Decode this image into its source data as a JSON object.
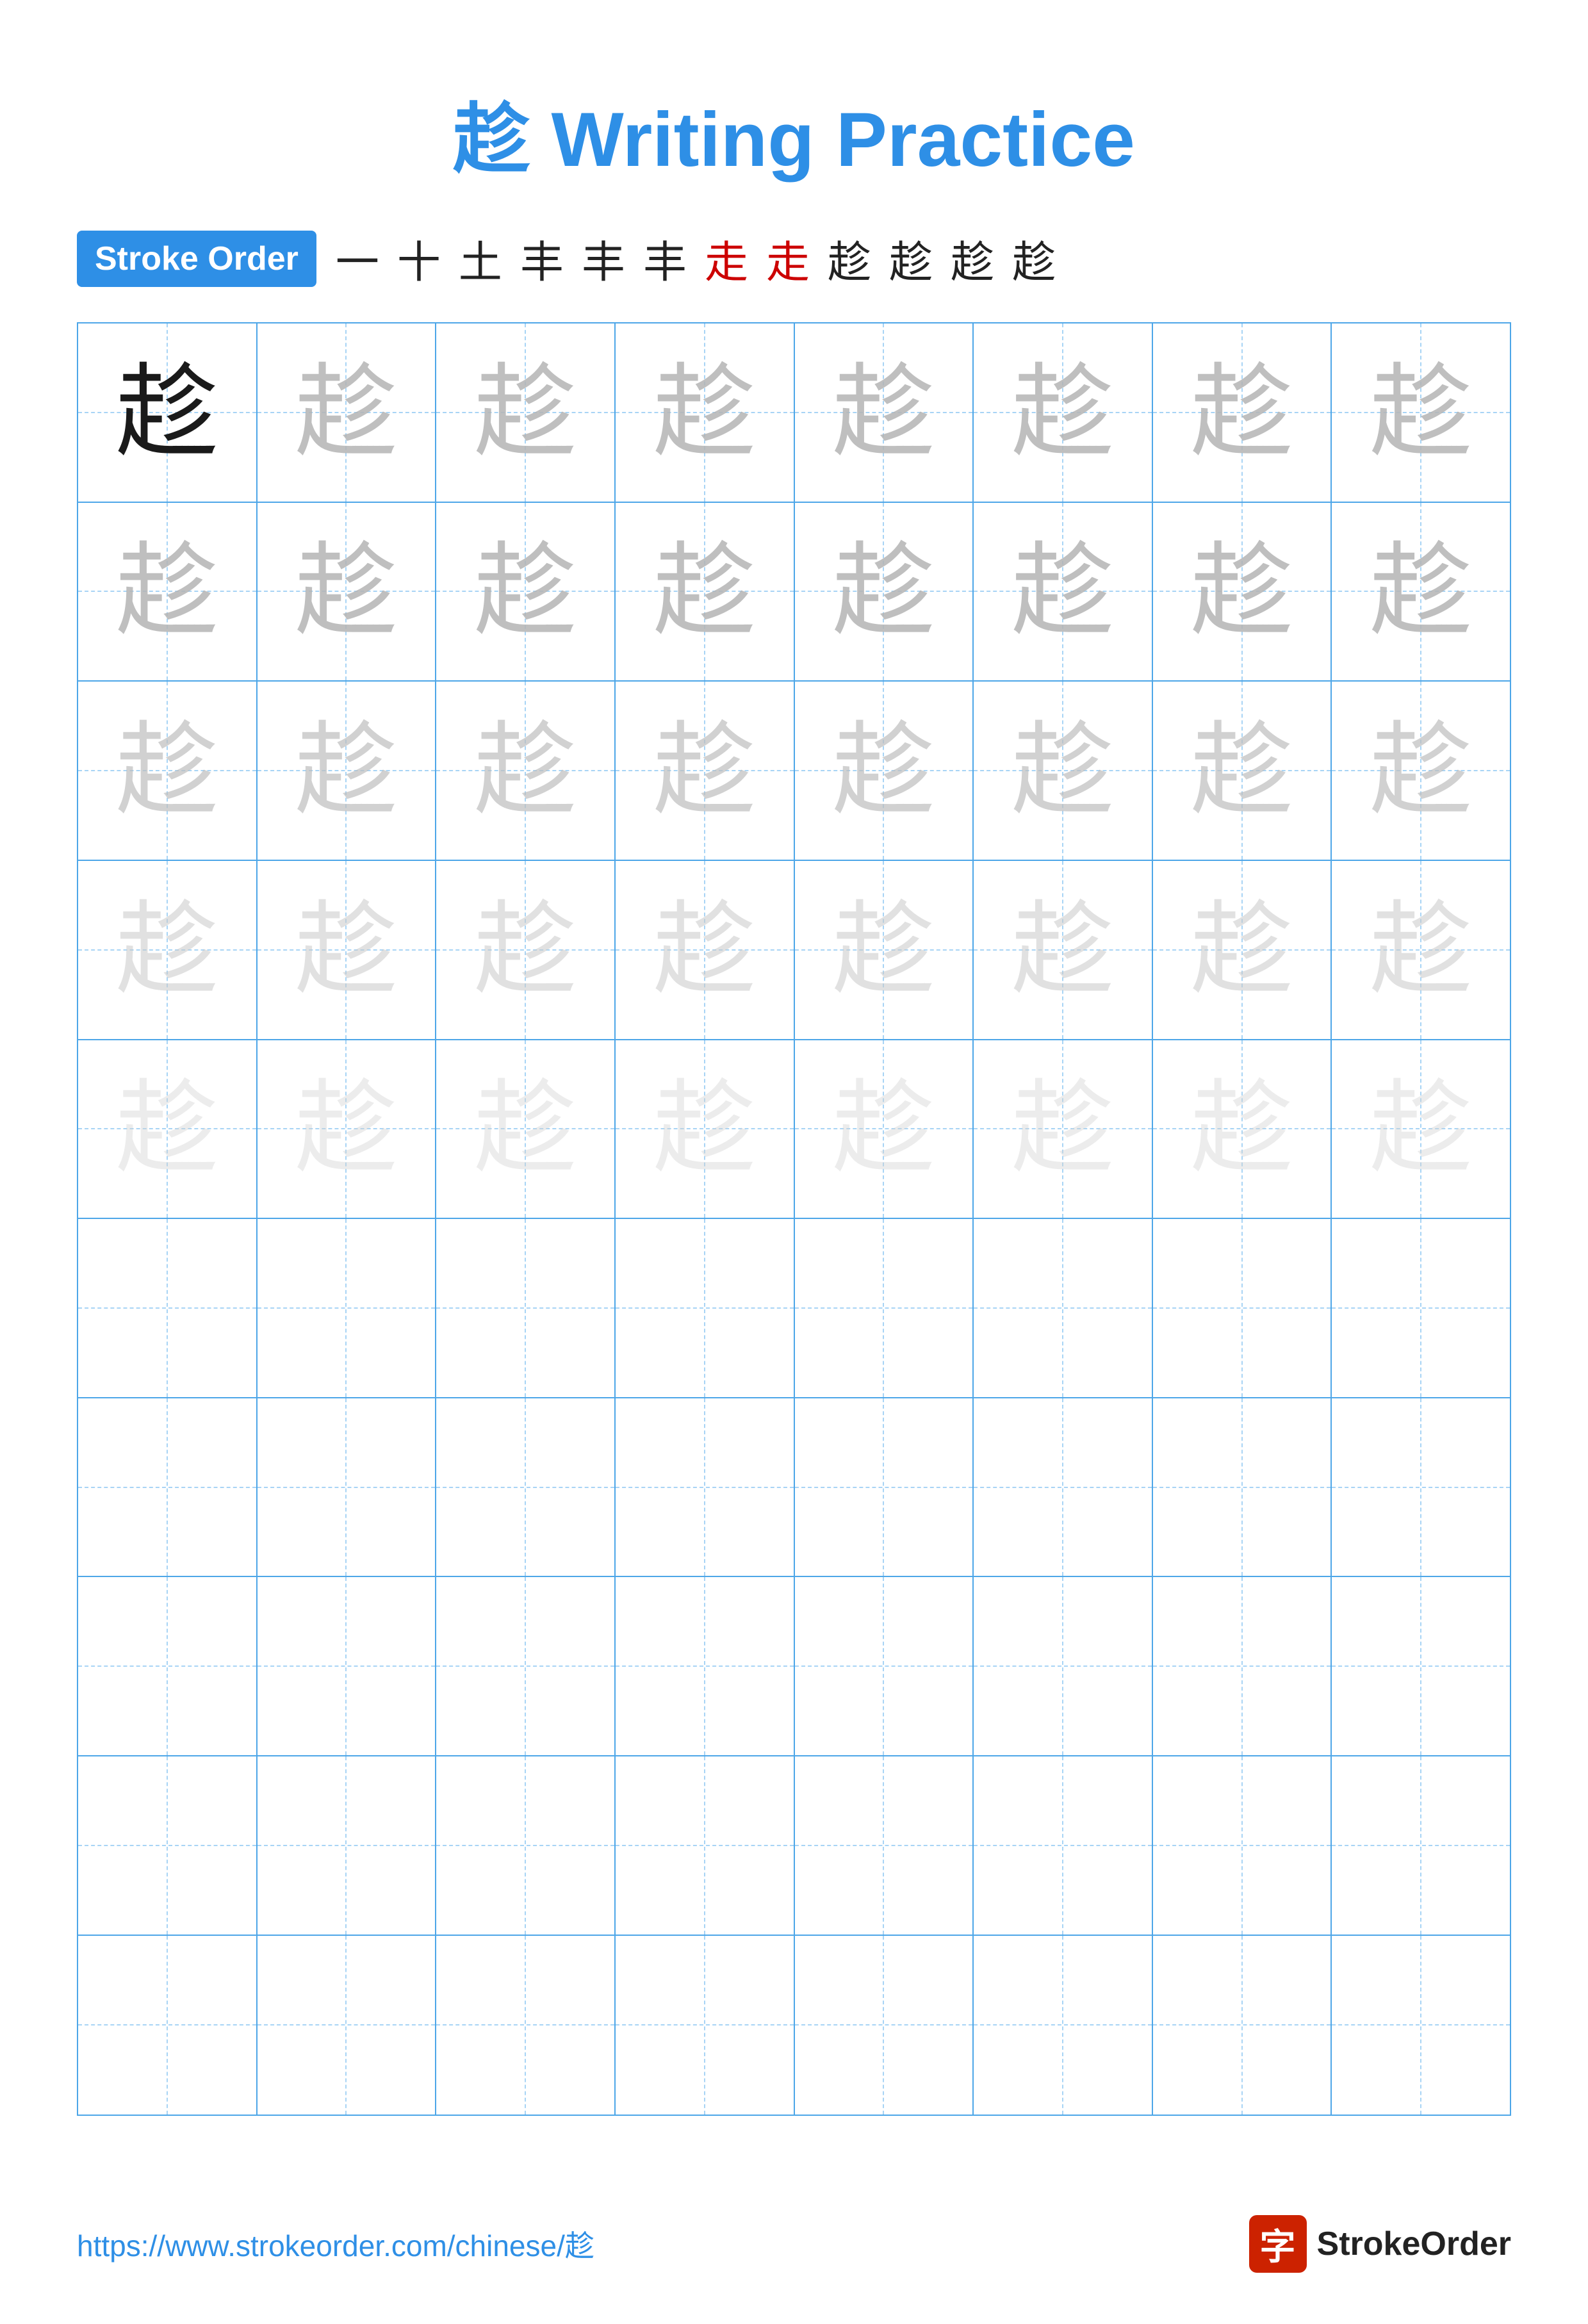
{
  "title": {
    "char": "趁",
    "text": " Writing Practice",
    "full": "趁 Writing Practice"
  },
  "stroke_order": {
    "badge_label": "Stroke Order",
    "strokes": [
      "一",
      "十",
      "土",
      "丰",
      "丰",
      "丰",
      "走",
      "走",
      "趁",
      "趁",
      "趁",
      "趁"
    ],
    "red_index": 6
  },
  "grid": {
    "rows": 10,
    "cols": 8,
    "char": "趁",
    "guide_rows": 5
  },
  "footer": {
    "url": "https://www.strokeorder.com/chinese/趁",
    "brand": "StrokeOrder"
  }
}
